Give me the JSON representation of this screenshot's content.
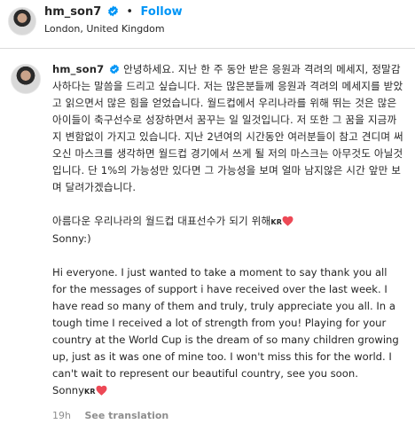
{
  "header": {
    "username": "hm_son7",
    "follow_label": "Follow",
    "location": "London, United Kingdom",
    "verified_icon": "verified-badge-icon"
  },
  "post": {
    "username": "hm_son7",
    "korean_paragraph": "안녕하세요. 지난 한 주 동안 받은 응원과 격려의 메세지, 정말감사하다는 말씀을 드리고 싶습니다. 저는 많은분들께 응원과 격려의 메세지를 받았고 읽으면서 많은 힘을 얻었습니다. 월드컵에서 우리나라를 위해 뛰는 것은 많은 아이들이 축구선수로 성장하면서 꿈꾸는 일 일것입니다. 저 또한 그 꿈을 지금까지 변함없이 가지고 있습니다. 지난 2년여의 시간동안 여러분들이 참고 견디며 써오신 마스크를 생각하면 월드컵 경기에서 쓰게 될 저의 마스크는 아무것도 아닐것입니다. 단 1%의 가능성만 있다면 그 가능성을 보며 얼마 남지않은 시간 앞만 보며 달려가겠습니다.",
    "korean_closing": "아름다운 우리나라의 월드컵 대표선수가 되기 위해",
    "korean_closing_flag": "KR",
    "korean_signature": "Sonny:)",
    "english_paragraph": "Hi everyone. I just wanted to take a moment to say thank you all for the messages of support i have received over the last week. I have read so many of them and truly, truly appreciate you all. In a tough time I received a lot of strength from you! Playing for your country at the World Cup is the dream of so many children growing up, just as it was one of mine too. I won't miss this for the world. I can't wait to represent our beautiful country, see you soon. Sonny",
    "english_flag": "KR",
    "heart_icon": "red-heart-icon",
    "heart_color": "#ed4956",
    "time_ago": "19h",
    "see_translation": "See translation"
  },
  "colors": {
    "follow": "#0095f6",
    "verified": "#0095f6",
    "meta": "#8e8e8e"
  }
}
